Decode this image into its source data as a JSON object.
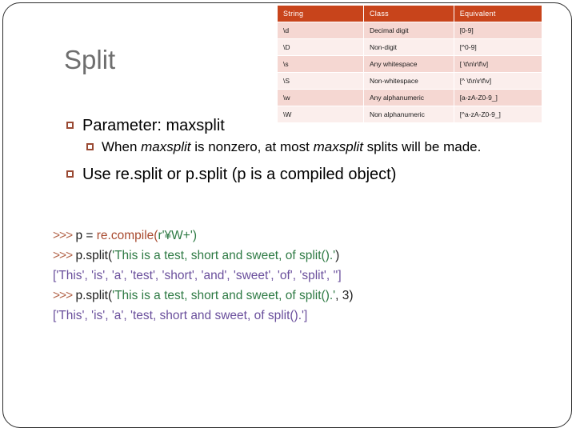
{
  "slide": {
    "title": "Split",
    "bullet_glyph": "square-outline"
  },
  "table": {
    "headers": [
      "String",
      "Class",
      "Equivalent"
    ],
    "rows": [
      {
        "string": "\\d",
        "class": "Decimal digit",
        "equivalent": "[0-9]"
      },
      {
        "string": "\\D",
        "class": "Non-digit",
        "equivalent": "[^0-9]"
      },
      {
        "string": "\\s",
        "class": "Any whitespace",
        "equivalent": "[ \\t\\n\\r\\f\\v]"
      },
      {
        "string": "\\S",
        "class": "Non-whitespace",
        "equivalent": "[^ \\t\\n\\r\\f\\v]"
      },
      {
        "string": "\\w",
        "class": "Any alphanumeric",
        "equivalent": "[a-zA-Z0-9_]"
      },
      {
        "string": "\\W",
        "class": "Non alphanumeric",
        "equivalent": "[^a-zA-Z0-9_]"
      }
    ],
    "header_color": "#c8441b",
    "row_color_odd": "#f5d7d2",
    "row_color_even": "#fbeeec"
  },
  "bullets": {
    "item1": "Parameter: maxsplit",
    "sub1_part1": "When ",
    "sub1_em1": "maxsplit",
    "sub1_part2": " is nonzero, at most ",
    "sub1_em2": "maxsplit",
    "sub1_part3": " splits will be made.",
    "item2": "Use re.split or p.split (p is a compiled object)"
  },
  "code": {
    "prompt": ">>>",
    "line1_stmt": "p = ",
    "line1_eq": "re.compile(",
    "line1_arg": "r'¥W+')",
    "line2_call": "p.split(",
    "line2_arg": "'This is a test, short and sweet, of split().'",
    "line2_tail": ")",
    "line3_out": "['This', 'is', 'a', 'test', 'short', 'and', 'sweet', 'of', 'split', '']",
    "line4_call": "p.split(",
    "line4_arg": "'This is a test, short and sweet, of split().'",
    "line4_tail": ", 3)",
    "line5_out": "['This', 'is', 'a', 'test, short and sweet, of split().']",
    "prompt_color": "#b4674d",
    "string_color": "#2e7a44",
    "output_color": "#6a4f9c"
  }
}
